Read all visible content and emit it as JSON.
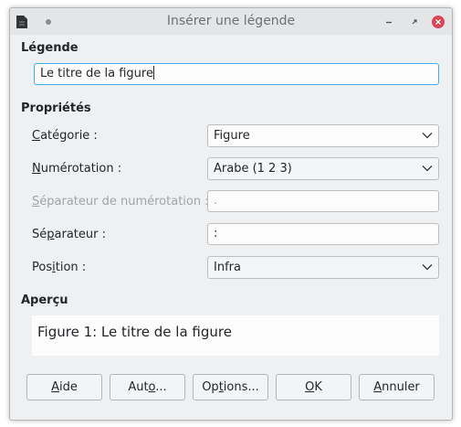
{
  "window": {
    "title": "Insérer une légende"
  },
  "legende": {
    "section_label": "Légende",
    "value": "Le titre de la figure"
  },
  "proprietes": {
    "section_label": "Propriétés",
    "categorie": {
      "label_u": "C",
      "label_rest": "atégorie :",
      "value": "Figure"
    },
    "numerotation": {
      "label_u": "N",
      "label_rest": "umérotation :",
      "value": "Arabe (1 2 3)"
    },
    "separateur_num": {
      "label_u": "S",
      "label_rest": "éparateur de numérotation :",
      "value": "."
    },
    "separateur": {
      "label_pre": "Sé",
      "label_u": "p",
      "label_rest": "arateur :",
      "value": ":"
    },
    "position": {
      "label_pre": "Pos",
      "label_u": "i",
      "label_rest": "tion :",
      "value": "Infra"
    }
  },
  "apercu": {
    "section_label": "Aperçu",
    "text": "Figure 1: Le titre de la figure"
  },
  "buttons": {
    "aide": {
      "u": "A",
      "rest": "ide"
    },
    "auto": {
      "pre": "Aut",
      "u": "o",
      "rest": "..."
    },
    "options": {
      "pre": "Op",
      "u": "t",
      "rest": "ions..."
    },
    "ok": {
      "u": "O",
      "rest": "K"
    },
    "annuler": {
      "u": "A",
      "rest": "nnuler"
    }
  },
  "colors": {
    "focus": "#3daee9",
    "close": "#da4453",
    "window_bg": "#eff0f1"
  }
}
